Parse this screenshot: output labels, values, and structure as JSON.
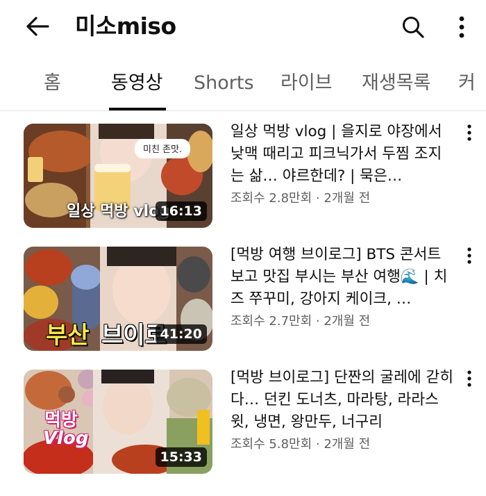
{
  "header": {
    "title": "미소miso",
    "back_icon": "back-arrow-icon",
    "search_icon": "search-icon",
    "more_icon": "more-vert-icon"
  },
  "tabs": [
    {
      "label": "홈",
      "active": false
    },
    {
      "label": "동영상",
      "active": true
    },
    {
      "label": "Shorts",
      "active": false
    },
    {
      "label": "라이브",
      "active": false
    },
    {
      "label": "재생목록",
      "active": false
    },
    {
      "label": "커",
      "active": false
    }
  ],
  "videos": [
    {
      "title": "일상 먹방 vlog | 을지로 야장에서 낮맥 때리고 피크닉가서 두찜 조지는 삶… 야르한데? | 묵은…",
      "views": "조회수 2.8만회",
      "age": "2개월 전",
      "duration": "16:13",
      "thumb_text": "일상 먹방 vlog",
      "thumb_bubble": "미친 존맛."
    },
    {
      "title": "[먹방 여행 브이로그] BTS 콘서트 보고 맛집 부시는 부산 여행🌊 | 치즈 쭈꾸미, 강아지 케이크, …",
      "views": "조회수 2.7만회",
      "age": "2개월 전",
      "duration": "41:20",
      "thumb_text_a": "부산",
      "thumb_text_b": "브이로"
    },
    {
      "title": "[먹방 브이로그] 단짠의 굴레에 갇히다… 던킨 도너츠, 마라탕, 라라스윗, 냉면, 왕만두, 너구리",
      "views": "조회수 5.8만회",
      "age": "2개월 전",
      "duration": "15:33",
      "thumb_text_a": "먹방",
      "thumb_text_b": "Vlog"
    }
  ],
  "meta_separator": " · "
}
